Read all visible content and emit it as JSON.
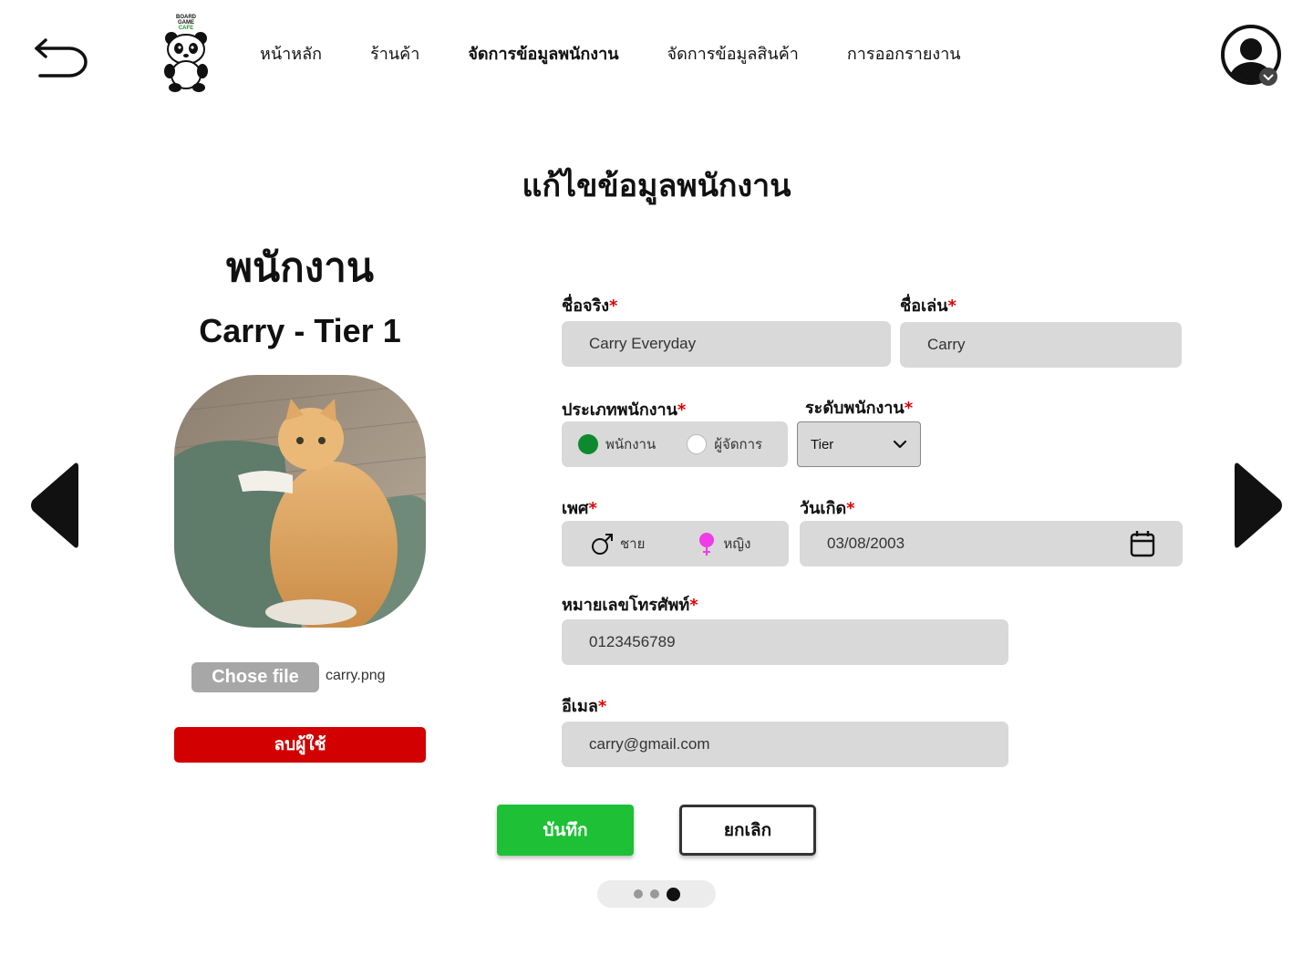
{
  "header": {
    "logo_text": [
      "BOARD",
      "GAME",
      "CAFE"
    ],
    "nav": [
      {
        "label": "หน้าหลัก",
        "active": false
      },
      {
        "label": "ร้านค้า",
        "active": false
      },
      {
        "label": "จัดการข้อมูลพนักงาน",
        "active": true
      },
      {
        "label": "จัดการข้อมูลสินค้า",
        "active": false
      },
      {
        "label": "การออกรายงาน",
        "active": false
      }
    ]
  },
  "page": {
    "title": "แก้ไขข้อมูลพนักงาน"
  },
  "employee": {
    "heading": "พนักงาน",
    "subtitle": "Carry - Tier 1",
    "file_button": "Chose file",
    "file_name": "carry.png",
    "delete_label": "ลบผู้ใช้"
  },
  "form": {
    "real_name": {
      "label": "ชื่อจริง",
      "value": "Carry Everyday"
    },
    "nickname": {
      "label": "ชื่อเล่น",
      "value": "Carry"
    },
    "employee_type": {
      "label": "ประเภทพนักงาน",
      "options": [
        {
          "label": "พนักงาน",
          "selected": true
        },
        {
          "label": "ผู้จัดการ",
          "selected": false
        }
      ]
    },
    "employee_level": {
      "label": "ระดับพนักงาน",
      "value": "Tier"
    },
    "gender": {
      "label": "เพศ",
      "options": [
        {
          "label": "ชาย",
          "icon": "male-icon"
        },
        {
          "label": "หญิง",
          "icon": "female-icon"
        }
      ]
    },
    "birthdate": {
      "label": "วันเกิด",
      "value": "03/08/2003"
    },
    "phone": {
      "label": "หมายเลขโทรศัพท์",
      "value": "0123456789"
    },
    "email": {
      "label": "อีเมล",
      "value": "carry@gmail.com"
    },
    "required_mark": "*"
  },
  "actions": {
    "save_label": "บันทึก",
    "cancel_label": "ยกเลิก"
  },
  "pager": {
    "pages": 3,
    "current": 3
  },
  "colors": {
    "save": "#1ec035",
    "delete": "#d20000",
    "selected_radio": "#0e8a2e",
    "female_icon": "#f03be6",
    "field_bg": "#d9d9d9"
  }
}
